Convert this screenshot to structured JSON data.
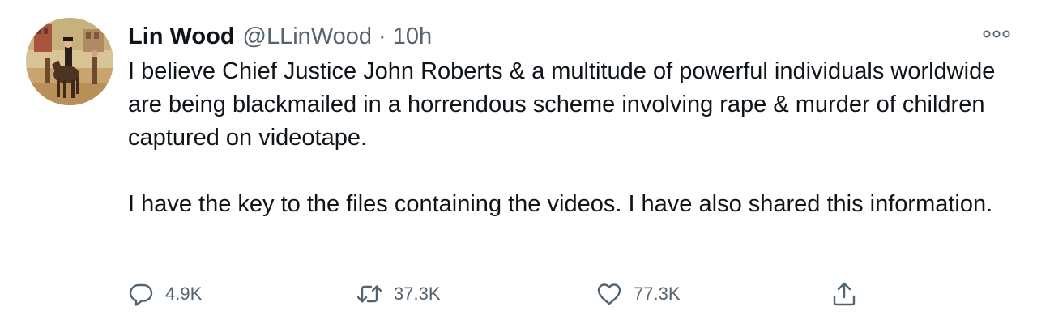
{
  "tweet": {
    "display_name": "Lin Wood",
    "handle": "@LLinWood",
    "separator": "·",
    "time": "10h",
    "text_paragraph_1": "I believe Chief Justice John Roberts & a multitude of powerful individuals worldwide are being blackmailed in a horrendous scheme involving rape & murder of children captured on videotape.",
    "text_paragraph_2": "I have the key to the files containing the videos. I have also shared this information.",
    "avatar_icon": "avatar-painting-horseman"
  },
  "actions": {
    "reply": {
      "icon": "reply-icon",
      "count": "4.9K"
    },
    "retweet": {
      "icon": "retweet-icon",
      "count": "37.3K"
    },
    "like": {
      "icon": "heart-icon",
      "count": "77.3K"
    },
    "share": {
      "icon": "share-icon"
    }
  },
  "more_menu_icon": "more-icon",
  "colors": {
    "text": "#0f1419",
    "secondary": "#536471",
    "background": "#ffffff"
  }
}
